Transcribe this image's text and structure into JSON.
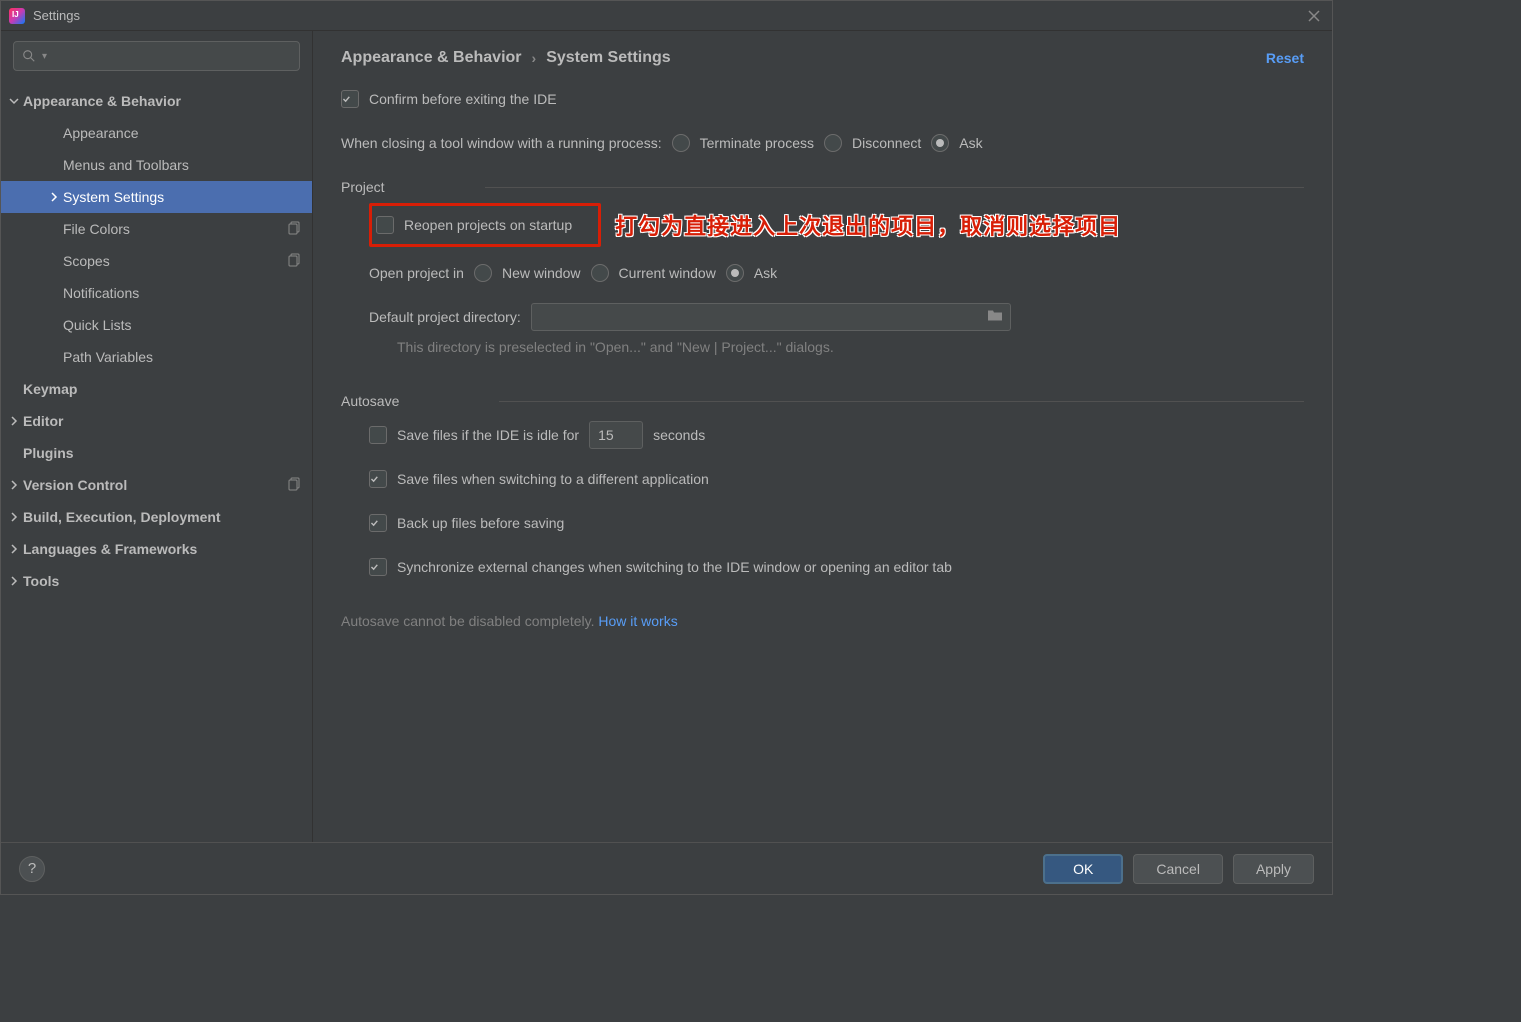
{
  "window": {
    "title": "Settings"
  },
  "breadcrumb": {
    "parent": "Appearance & Behavior",
    "current": "System Settings"
  },
  "reset": "Reset",
  "sidebar": {
    "items": [
      {
        "label": "Appearance & Behavior",
        "level": 1,
        "bold": true,
        "expanded": true
      },
      {
        "label": "Appearance",
        "level": 2
      },
      {
        "label": "Menus and Toolbars",
        "level": 2
      },
      {
        "label": "System Settings",
        "level": 2,
        "selected": true,
        "hasChildren": true
      },
      {
        "label": "File Colors",
        "level": 2,
        "copyIcon": true
      },
      {
        "label": "Scopes",
        "level": 2,
        "copyIcon": true
      },
      {
        "label": "Notifications",
        "level": 2
      },
      {
        "label": "Quick Lists",
        "level": 2
      },
      {
        "label": "Path Variables",
        "level": 2
      },
      {
        "label": "Keymap",
        "level": 1,
        "bold": true
      },
      {
        "label": "Editor",
        "level": 1,
        "bold": true,
        "hasChildren": true
      },
      {
        "label": "Plugins",
        "level": 1,
        "bold": true
      },
      {
        "label": "Version Control",
        "level": 1,
        "bold": true,
        "hasChildren": true,
        "copyIcon": true
      },
      {
        "label": "Build, Execution, Deployment",
        "level": 1,
        "bold": true,
        "hasChildren": true
      },
      {
        "label": "Languages & Frameworks",
        "level": 1,
        "bold": true,
        "hasChildren": true
      },
      {
        "label": "Tools",
        "level": 1,
        "bold": true,
        "hasChildren": true
      }
    ]
  },
  "top": {
    "confirm_exit": "Confirm before exiting the IDE",
    "closing_label": "When closing a tool window with a running process:",
    "opt_terminate": "Terminate process",
    "opt_disconnect": "Disconnect",
    "opt_ask": "Ask"
  },
  "project_group": {
    "title": "Project",
    "reopen": "Reopen projects on startup",
    "annotation": "打勾为直接进入上次退出的项目，取消则选择项目",
    "open_in_label": "Open project in",
    "opt_new": "New window",
    "opt_current": "Current window",
    "opt_ask": "Ask",
    "default_dir_label": "Default project directory:",
    "default_dir_value": "",
    "default_dir_hint": "This directory is preselected in \"Open...\" and \"New | Project...\" dialogs."
  },
  "autosave_group": {
    "title": "Autosave",
    "idle_label_pre": "Save files if the IDE is idle for",
    "idle_value": "15",
    "idle_label_post": "seconds",
    "switch_app": "Save files when switching to a different application",
    "backup": "Back up files before saving",
    "sync": "Synchronize external changes when switching to the IDE window or opening an editor tab",
    "note_pre": "Autosave cannot be disabled completely. ",
    "note_link": "How it works"
  },
  "footer": {
    "ok": "OK",
    "cancel": "Cancel",
    "apply": "Apply"
  }
}
